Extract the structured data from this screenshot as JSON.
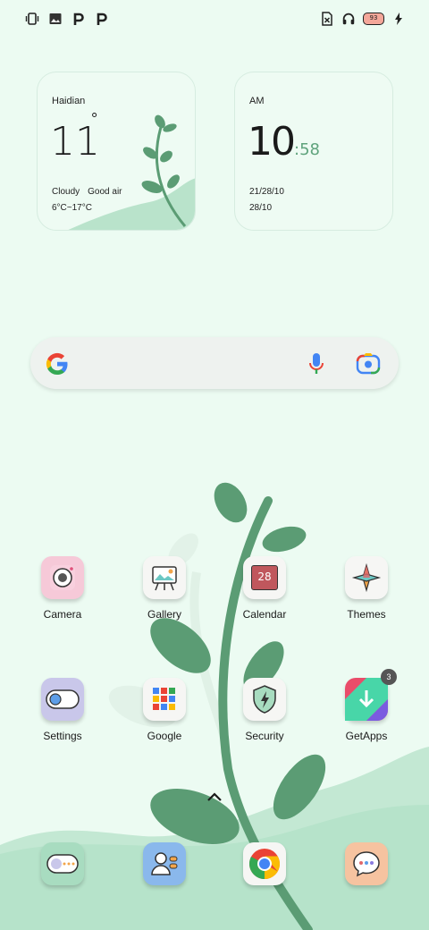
{
  "status_bar": {
    "left_icons": [
      "vibrate-icon",
      "image-icon",
      "p-icon",
      "p-icon"
    ],
    "right_icons": [
      "no-sim-icon",
      "headset-icon",
      "battery-icon",
      "charging-icon"
    ],
    "battery_level": "93"
  },
  "weather_widget": {
    "city": "Haidian",
    "temperature": "11",
    "degree_symbol": "°",
    "condition": "Cloudy",
    "air_quality": "Good air",
    "range": "6°C~17°C"
  },
  "clock_widget": {
    "ampm": "AM",
    "hour": "10",
    "minutes": ":58",
    "date_line1": "21/28/10",
    "date_line2": "28/10"
  },
  "search_bar": {
    "icons": [
      "google-logo-icon",
      "microphone-icon",
      "lens-camera-icon"
    ]
  },
  "apps_row1": [
    {
      "label": "Camera",
      "icon": "camera-icon"
    },
    {
      "label": "Gallery",
      "icon": "gallery-icon"
    },
    {
      "label": "Calendar",
      "icon": "calendar-icon",
      "date": "28"
    },
    {
      "label": "Themes",
      "icon": "themes-icon"
    }
  ],
  "apps_row2": [
    {
      "label": "Settings",
      "icon": "settings-icon"
    },
    {
      "label": "Google",
      "icon": "google-folder-icon"
    },
    {
      "label": "Security",
      "icon": "security-icon"
    },
    {
      "label": "GetApps",
      "icon": "getapps-icon",
      "badge": "3"
    }
  ],
  "dock": [
    {
      "icon": "messaging-bubble-icon"
    },
    {
      "icon": "contacts-icon"
    },
    {
      "icon": "chrome-icon"
    },
    {
      "icon": "messages-icon"
    }
  ],
  "colors": {
    "background": "#ecfbf2",
    "leaf_green": "#5b9c74",
    "hill_green": "#bfe6cf"
  }
}
